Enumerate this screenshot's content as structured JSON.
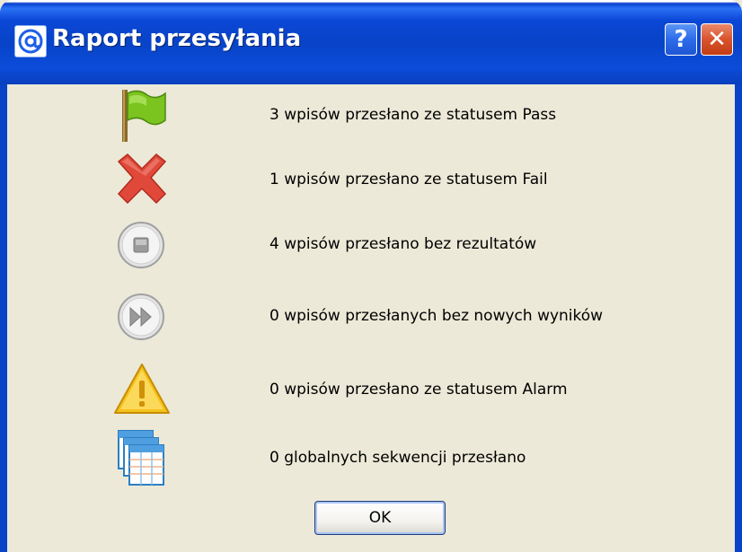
{
  "window": {
    "title": "Raport przesyłania",
    "help_label": "?",
    "close_label": "✕"
  },
  "rows": [
    {
      "icon": "green-flag-icon",
      "text": "3 wpisów przesłano ze statusem Pass"
    },
    {
      "icon": "red-x-icon",
      "text": "1 wpisów przesłano ze statusem Fail"
    },
    {
      "icon": "stop-circle-icon",
      "text": "4 wpisów przesłano bez rezultatów"
    },
    {
      "icon": "fast-forward-circle-icon",
      "text": "0 wpisów przesłanych bez nowych wyników"
    },
    {
      "icon": "warning-triangle-icon",
      "text": "0 wpisów przesłano ze statusem Alarm"
    },
    {
      "icon": "sequences-icon",
      "text": "0 globalnych sekwencji przesłano"
    }
  ],
  "ok_label": "OK",
  "colors": {
    "titlebar": "#0843c8",
    "dialog_bg": "#ece9d8",
    "pass": "#7bc41f",
    "fail": "#e0493a",
    "alarm": "#f4c21a"
  }
}
